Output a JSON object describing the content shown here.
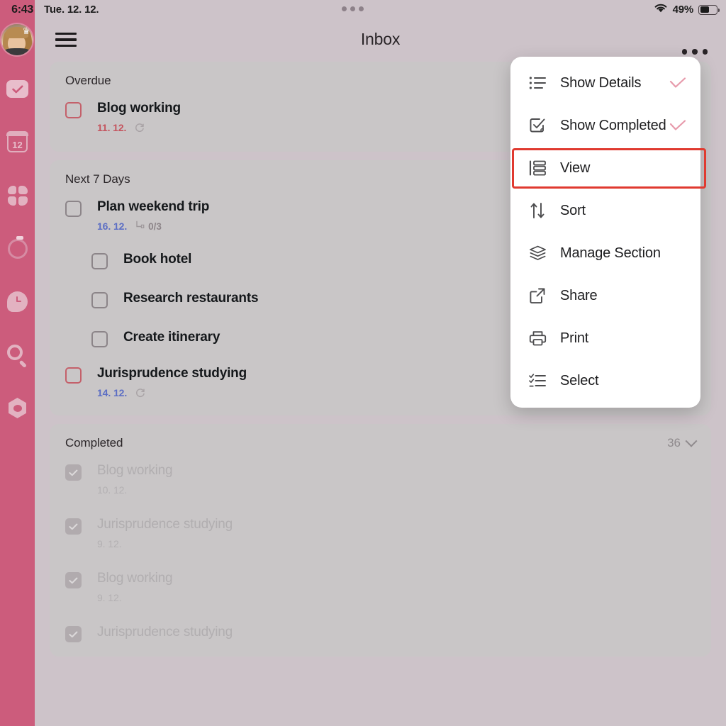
{
  "status_bar": {
    "time": "6:43",
    "date": "Tue. 12. 12.",
    "battery_percent": "49%",
    "wifi_icon": "wifi-icon",
    "battery_icon": "battery-icon",
    "dots_icon": "recording-dots-icon"
  },
  "sidebar": {
    "avatar_name": "user-avatar",
    "crown_badge": "♛",
    "items": [
      {
        "name": "tasks",
        "icon": "checkmark-box-icon"
      },
      {
        "name": "calendar",
        "icon": "calendar-icon",
        "label": "12"
      },
      {
        "name": "matrix",
        "icon": "grid-quadrant-icon"
      },
      {
        "name": "pomodoro",
        "icon": "timer-circle-icon"
      },
      {
        "name": "habit",
        "icon": "clock-pin-icon"
      },
      {
        "name": "search",
        "icon": "search-icon"
      },
      {
        "name": "settings",
        "icon": "gear-hex-icon"
      }
    ]
  },
  "header": {
    "menu_icon": "hamburger-menu-icon",
    "title": "Inbox",
    "more_icon": "more-options-icon"
  },
  "sections": [
    {
      "title": "Overdue",
      "count": "",
      "tasks": [
        {
          "title": "Blog working",
          "date": "11. 12.",
          "date_color": "red",
          "recurring": true,
          "checkbox": "unchecked-overdue",
          "subtasks": []
        }
      ]
    },
    {
      "title": "Next 7 Days",
      "count": "",
      "tasks": [
        {
          "title": "Plan weekend trip",
          "date": "16. 12.",
          "date_color": "blue",
          "recurring": false,
          "subtask_progress": "0/3",
          "checkbox": "unchecked",
          "subtasks": [
            {
              "title": "Book hotel",
              "checkbox": "unchecked"
            },
            {
              "title": "Research restaurants",
              "checkbox": "unchecked"
            },
            {
              "title": "Create itinerary",
              "checkbox": "unchecked"
            }
          ]
        },
        {
          "title": "Jurisprudence studying",
          "date": "14. 12.",
          "date_color": "blue",
          "recurring": true,
          "checkbox": "unchecked-overdue",
          "subtasks": []
        }
      ]
    },
    {
      "title": "Completed",
      "count": "36",
      "collapse_icon": "chevron-down-icon",
      "tasks": [
        {
          "title": "Blog working",
          "date": "10. 12.",
          "checkbox": "checked"
        },
        {
          "title": "Jurisprudence studying",
          "date": "9. 12.",
          "checkbox": "checked"
        },
        {
          "title": "Blog working",
          "date": "9. 12.",
          "checkbox": "checked"
        },
        {
          "title": "Jurisprudence studying",
          "date": "",
          "checkbox": "checked"
        }
      ]
    }
  ],
  "menu": {
    "items": [
      {
        "label": "Show Details",
        "icon": "list-details-icon",
        "checked": true
      },
      {
        "label": "Show Completed",
        "icon": "checkbox-task-icon",
        "checked": true
      },
      {
        "label": "View",
        "icon": "view-layout-icon",
        "checked": false,
        "highlighted": true
      },
      {
        "label": "Sort",
        "icon": "sort-arrows-icon",
        "checked": false
      },
      {
        "label": "Manage Section",
        "icon": "layers-icon",
        "checked": false
      },
      {
        "label": "Share",
        "icon": "share-external-icon",
        "checked": false
      },
      {
        "label": "Print",
        "icon": "printer-icon",
        "checked": false
      },
      {
        "label": "Select",
        "icon": "select-list-icon",
        "checked": false
      }
    ]
  },
  "colors": {
    "sidebar_pink": "#cc5c7c",
    "background": "#cdc3c9",
    "card": "#c9c6c7",
    "highlight_red": "#e03a30",
    "check_pink": "#e79aab",
    "overdue_red": "#c4545e",
    "date_blue": "#5c6ec4"
  }
}
